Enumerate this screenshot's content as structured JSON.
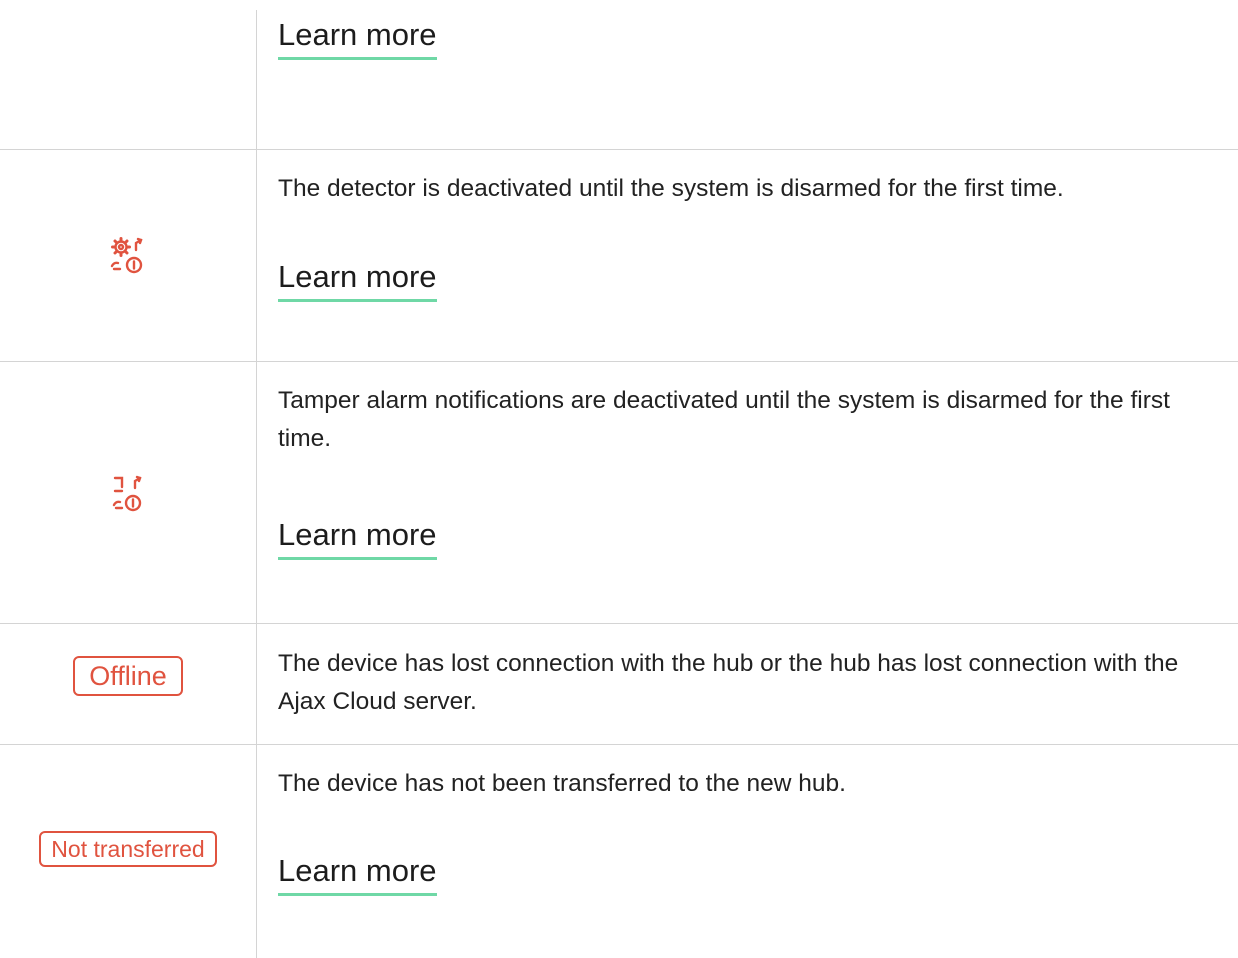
{
  "rows": [
    {
      "icon": "none",
      "description": "",
      "link": "Learn more"
    },
    {
      "icon": "gear-first-disarm-icon",
      "description": "The detector is deactivated until the system is disarmed for the first time.",
      "link": "Learn more"
    },
    {
      "icon": "tamper-first-disarm-icon",
      "description": "Tamper alarm notifications are deactivated until the system is disarmed for the first time.",
      "link": "Learn more"
    },
    {
      "badge": "Offline",
      "description": "The device has lost connection with the hub or the hub has lost connection with the Ajax Cloud server."
    },
    {
      "badge": "Not transferred",
      "description": "The device has not been transferred to the new hub.",
      "link": "Learn more"
    }
  ],
  "colors": {
    "accent_red": "#e0533f",
    "link_underline": "#6fd8a6",
    "border": "#d4d4d4",
    "text": "#222222"
  }
}
